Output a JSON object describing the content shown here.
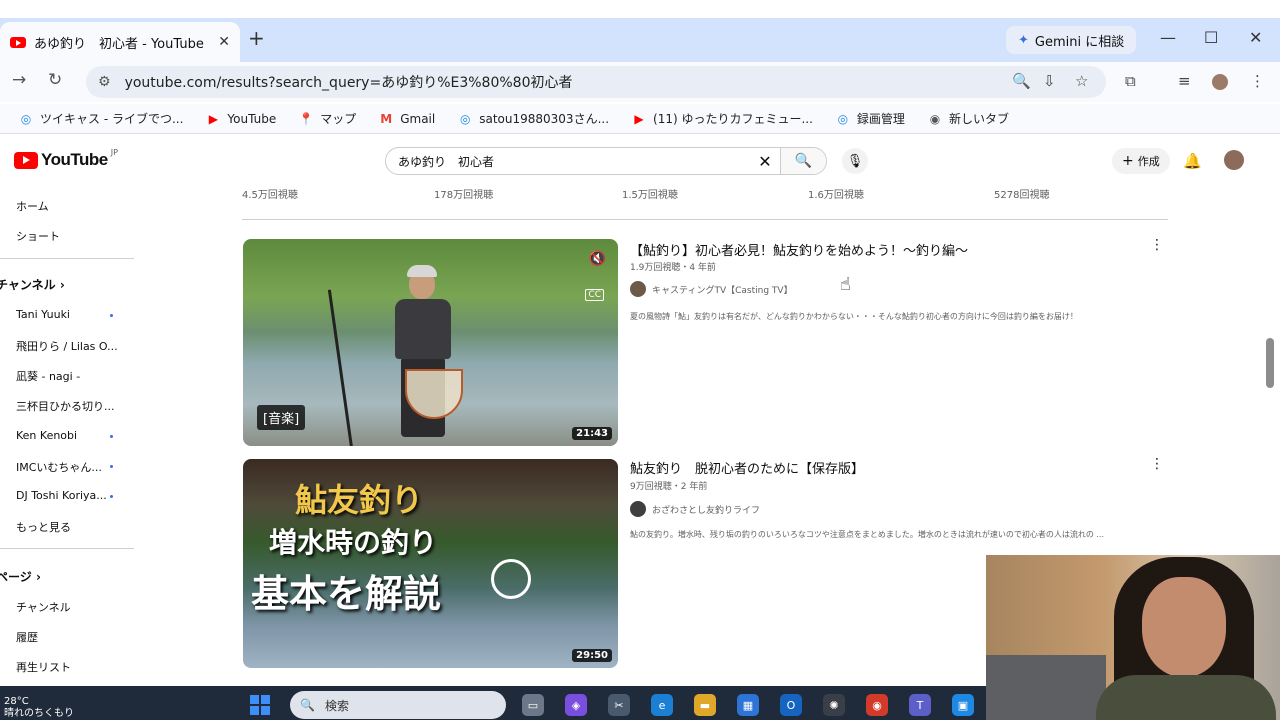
{
  "browser": {
    "tab_title": "あゆ釣り　初心者 - YouTube",
    "tab_close": "✕",
    "new_tab": "+",
    "gemini_label": "Gemini に相談",
    "url": "youtube.com/results?search_query=あゆ釣り%E3%80%80初心者",
    "window_controls": [
      "—",
      "☐",
      "✕"
    ],
    "bookmarks": [
      {
        "icon": "casting-icon",
        "label": "ツイキャス - ライブでつ..."
      },
      {
        "icon": "youtube-icon",
        "label": "YouTube"
      },
      {
        "icon": "map-pin-icon",
        "label": "マップ"
      },
      {
        "icon": "gmail-icon",
        "label": "Gmail"
      },
      {
        "icon": "casting-icon",
        "label": "satou19880303さん..."
      },
      {
        "icon": "youtube-icon",
        "label": "(11) ゆったりカフェミュー..."
      },
      {
        "icon": "casting-icon",
        "label": "録画管理"
      },
      {
        "icon": "chrome-icon",
        "label": "新しいタブ"
      }
    ]
  },
  "youtube": {
    "logo_text": "YouTube",
    "logo_region": "JP",
    "search_value": "あゆ釣り　初心者",
    "create_label": "作成",
    "sidebar": {
      "home": "ホーム",
      "shorts": "ショート",
      "channels_header": "チャンネル",
      "subscriptions": [
        "Tani Yuuki",
        "飛田りら / Lilas O...",
        "凪葵 - nagi -",
        "三杯目ひかる切り...",
        "Ken Kenobi",
        "IMCいむちゃん...",
        "DJ Toshi Koriya..."
      ],
      "more": "もっと見る",
      "page_header": "ページ",
      "channel": "チャンネル",
      "history": "履歴",
      "playlists": "再生リスト"
    },
    "view_counts_row": [
      "4.5万回視聴",
      "178万回視聴",
      "1.5万回視聴",
      "1.6万回視聴",
      "5278回視聴"
    ],
    "videos": [
      {
        "title": "【鮎釣り】初心者必見！鮎友釣りを始めよう！～釣り編～",
        "meta": "1.9万回視聴・4 年前",
        "channel": "キャスティングTV【Casting TV】",
        "description": "夏の風物詩「鮎」友釣りは有名だが、どんな釣りかわからない・・・そんな鮎釣り初心者の方向けに今回は釣り編をお届け！",
        "tag": "[音楽]",
        "duration": "21:43"
      },
      {
        "title": "鮎友釣り　脱初心者のために【保存版】",
        "meta": "9万回視聴・2 年前",
        "channel": "おざわさとし友釣りライフ",
        "description": "鮎の友釣り。増水時、残り垢の釣りのいろいろなコツや注意点をまとめました。増水のときは流れが速いので初心者の人は流れの ...",
        "thumb_lines": [
          "鮎友釣り",
          "増水時の釣り",
          "基本を解説"
        ],
        "duration": "29:50"
      }
    ]
  },
  "taskbar": {
    "temperature": "28°C",
    "weather": "晴れのちくもり",
    "search_placeholder": "検索"
  }
}
